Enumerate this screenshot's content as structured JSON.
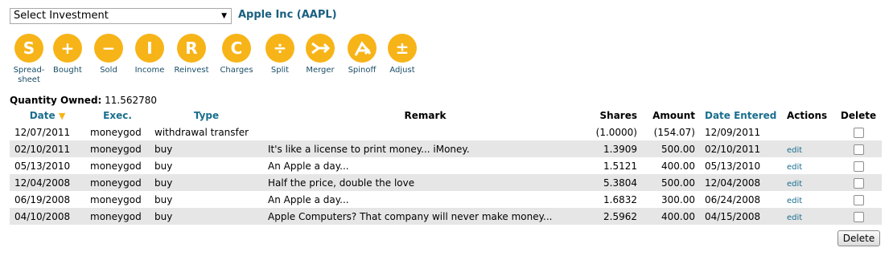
{
  "selector": {
    "value": "Select Investment"
  },
  "investment_title": "Apple Inc (AAPL)",
  "toolbar": [
    {
      "symbol": "S",
      "label": "Spread-sheet",
      "icon": "spreadsheet-icon"
    },
    {
      "symbol": "+",
      "label": "Bought",
      "icon": "plus-icon"
    },
    {
      "symbol": "−",
      "label": "Sold",
      "icon": "minus-icon"
    },
    {
      "symbol": "I",
      "label": "Income",
      "icon": "income-icon"
    },
    {
      "symbol": "R",
      "label": "Reinvest",
      "icon": "reinvest-icon"
    },
    {
      "symbol": "C",
      "label": "Charges",
      "icon": "charges-icon"
    },
    {
      "symbol": "÷",
      "label": "Split",
      "icon": "split-icon"
    },
    {
      "symbol": "",
      "label": "Merger",
      "icon": "merger-icon"
    },
    {
      "symbol": "",
      "label": "Spinoff",
      "icon": "spinoff-icon"
    },
    {
      "symbol": "±",
      "label": "Adjust",
      "icon": "adjust-icon"
    }
  ],
  "quantity": {
    "label": "Quantity Owned:",
    "value": "11.562780"
  },
  "table": {
    "headers": {
      "date": "Date",
      "exec": "Exec.",
      "type": "Type",
      "remark": "Remark",
      "shares": "Shares",
      "amount": "Amount",
      "entered": "Date Entered",
      "actions": "Actions",
      "delete": "Delete"
    },
    "rows": [
      {
        "date": "12/07/2011",
        "exec": "moneygod",
        "type": "withdrawal transfer",
        "remark": "",
        "shares": "(1.0000)",
        "amount": "(154.07)",
        "entered": "12/09/2011",
        "action": ""
      },
      {
        "date": "02/10/2011",
        "exec": "moneygod",
        "type": "buy",
        "remark": "It's like a license to print money... iMoney.",
        "shares": "1.3909",
        "amount": "500.00",
        "entered": "02/10/2011",
        "action": "edit"
      },
      {
        "date": "05/13/2010",
        "exec": "moneygod",
        "type": "buy",
        "remark": "An Apple a day...",
        "shares": "1.5121",
        "amount": "400.00",
        "entered": "05/13/2010",
        "action": "edit"
      },
      {
        "date": "12/04/2008",
        "exec": "moneygod",
        "type": "buy",
        "remark": "Half the price, double the love",
        "shares": "5.3804",
        "amount": "500.00",
        "entered": "12/04/2008",
        "action": "edit"
      },
      {
        "date": "06/19/2008",
        "exec": "moneygod",
        "type": "buy",
        "remark": "An Apple a day...",
        "shares": "1.6832",
        "amount": "300.00",
        "entered": "06/24/2008",
        "action": "edit"
      },
      {
        "date": "04/10/2008",
        "exec": "moneygod",
        "type": "buy",
        "remark": "Apple Computers? That company will never make money...",
        "shares": "2.5962",
        "amount": "400.00",
        "entered": "04/15/2008",
        "action": "edit"
      }
    ]
  },
  "delete_button": "Delete",
  "colors": {
    "accent": "#f7b418",
    "link": "#1a6e8e",
    "row_alt": "#e6e6e6"
  }
}
